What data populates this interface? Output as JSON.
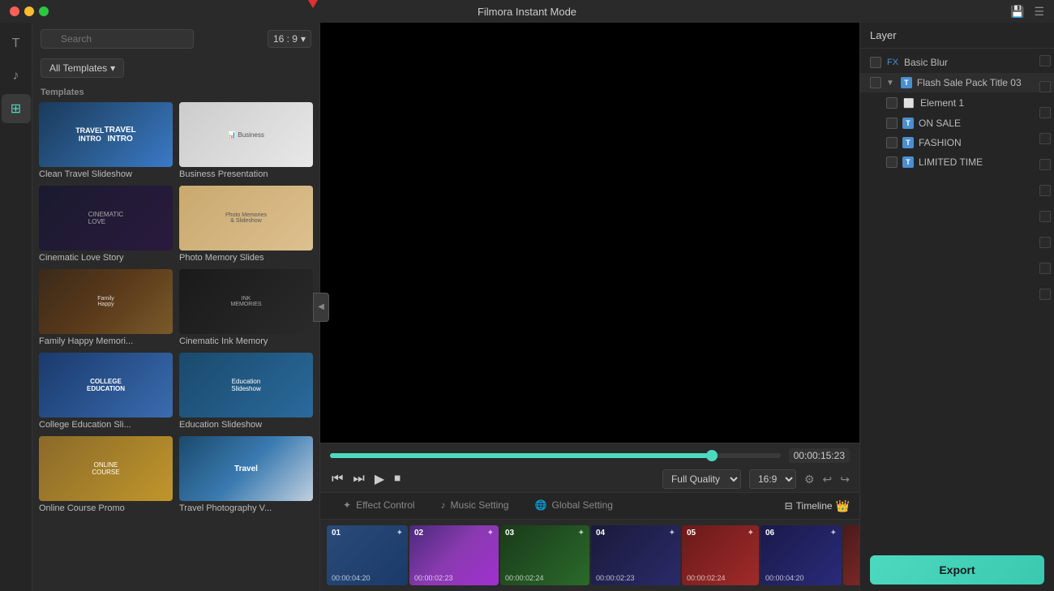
{
  "app": {
    "title": "Filmora Instant Mode"
  },
  "titlebar": {
    "title": "Filmora Instant Mode",
    "icon_save": "💾",
    "icon_menu": "☰"
  },
  "sidebar": {
    "items": [
      {
        "id": "text",
        "icon": "T",
        "label": "Text"
      },
      {
        "id": "music",
        "icon": "♪",
        "label": "Music"
      },
      {
        "id": "template",
        "icon": "⊞",
        "label": "Template",
        "active": true
      }
    ]
  },
  "templates_panel": {
    "search_placeholder": "Search",
    "aspect_ratio": "16 : 9",
    "all_templates_label": "All Templates",
    "section_label": "Templates",
    "templates": [
      {
        "id": 1,
        "label": "Clean Travel Slideshow",
        "thumb_class": "thumb-travel"
      },
      {
        "id": 2,
        "label": "Business Presentation",
        "thumb_class": "thumb-business"
      },
      {
        "id": 3,
        "label": "Cinematic Love Story",
        "thumb_class": "thumb-love"
      },
      {
        "id": 4,
        "label": "Photo Memory Slides",
        "thumb_class": "thumb-photo"
      },
      {
        "id": 5,
        "label": "Family Happy Memori...",
        "thumb_class": "thumb-family"
      },
      {
        "id": 6,
        "label": "Cinematic Ink Memory",
        "thumb_class": "thumb-ink"
      },
      {
        "id": 7,
        "label": "College Education Sli...",
        "thumb_class": "thumb-college"
      },
      {
        "id": 8,
        "label": "Education Slideshow",
        "thumb_class": "thumb-education"
      },
      {
        "id": 9,
        "label": "Online Course Promo",
        "thumb_class": "thumb-online"
      },
      {
        "id": 10,
        "label": "Travel Photography V...",
        "thumb_class": "thumb-travel2"
      }
    ]
  },
  "preview": {
    "progress_percent": 85,
    "time_display": "00:00:15:23",
    "quality": "Full Quality",
    "aspect": "16:9"
  },
  "transport": {
    "rewind_label": "⏮",
    "forward_label": "⏭",
    "play_label": "▶",
    "stop_label": "⏹",
    "undo_label": "↩",
    "redo_label": "↪"
  },
  "bottom_tabs": [
    {
      "id": "effect",
      "label": "Effect Control",
      "icon": "✦",
      "active": false
    },
    {
      "id": "music",
      "label": "Music Setting",
      "icon": "♪",
      "active": false
    },
    {
      "id": "global",
      "label": "Global Setting",
      "icon": "🌐",
      "active": false
    }
  ],
  "timeline_label": "Timeline",
  "clips": [
    {
      "num": "01",
      "time": "00:00:04:20",
      "class": "clip-1"
    },
    {
      "num": "02",
      "time": "00:00:02:23",
      "class": "clip-2"
    },
    {
      "num": "03",
      "time": "00:00:02:24",
      "class": "clip-3"
    },
    {
      "num": "04",
      "time": "00:00:02:23",
      "class": "clip-4"
    },
    {
      "num": "05",
      "time": "00:00:02:24",
      "class": "clip-5"
    },
    {
      "num": "06",
      "time": "00:00:04:20",
      "class": "clip-6"
    }
  ],
  "layer_panel": {
    "title": "Layer",
    "items": [
      {
        "id": "basic-blur",
        "label": "Basic Blur",
        "type": "fx",
        "indent": 0
      },
      {
        "id": "flash-sale",
        "label": "Flash Sale Pack Title 03",
        "type": "group",
        "indent": 0,
        "expanded": true
      },
      {
        "id": "element1",
        "label": "Element 1",
        "type": "img",
        "indent": 1
      },
      {
        "id": "on-sale",
        "label": "ON SALE",
        "type": "text",
        "indent": 1
      },
      {
        "id": "fashion",
        "label": "FASHION",
        "type": "text",
        "indent": 1
      },
      {
        "id": "limited-time",
        "label": "LIMITED TIME",
        "type": "text",
        "indent": 1
      }
    ]
  },
  "export_btn_label": "Export"
}
